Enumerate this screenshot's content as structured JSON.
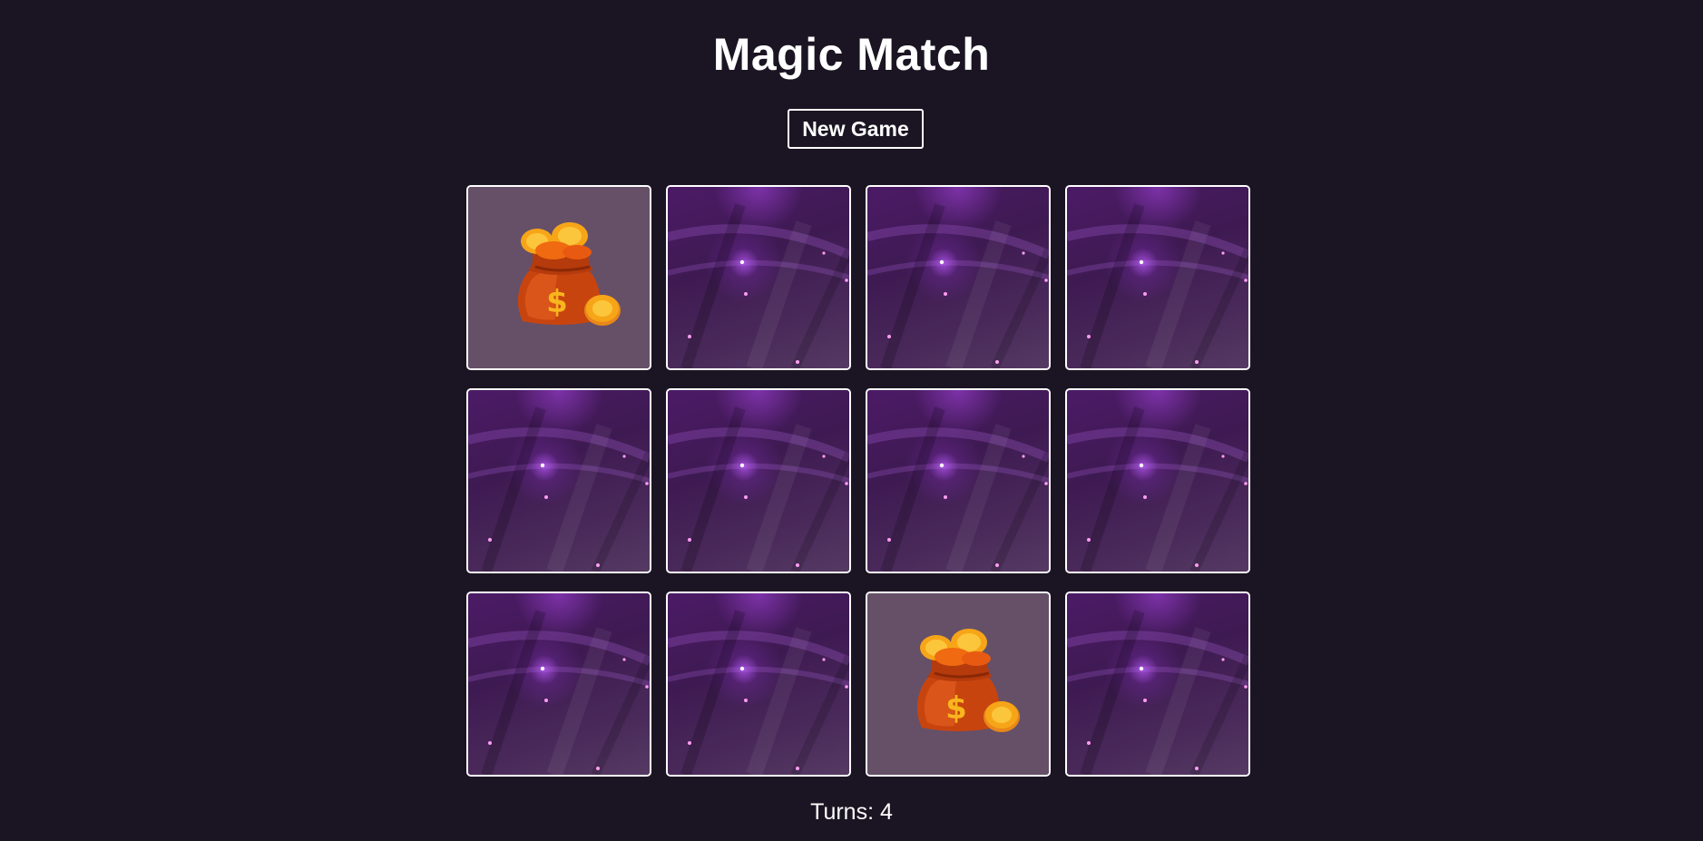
{
  "game": {
    "title": "Magic Match",
    "new_game_label": "New Game",
    "turns_label": "Turns:",
    "turns_value": "4",
    "turns_text": "Turns: 4"
  },
  "cards": [
    {
      "state": "face-up",
      "icon": "money-bag-icon"
    },
    {
      "state": "face-down",
      "icon": "card-back-icon"
    },
    {
      "state": "face-down",
      "icon": "card-back-icon"
    },
    {
      "state": "face-down",
      "icon": "card-back-icon"
    },
    {
      "state": "face-down",
      "icon": "card-back-icon"
    },
    {
      "state": "face-down",
      "icon": "card-back-icon"
    },
    {
      "state": "face-down",
      "icon": "card-back-icon"
    },
    {
      "state": "face-down",
      "icon": "card-back-icon"
    },
    {
      "state": "face-down",
      "icon": "card-back-icon"
    },
    {
      "state": "face-down",
      "icon": "card-back-icon"
    },
    {
      "state": "face-up",
      "icon": "money-bag-icon"
    },
    {
      "state": "face-down",
      "icon": "card-back-icon"
    }
  ],
  "colors": {
    "background": "#1b1523",
    "card_border": "#ffffff",
    "face_up_background": "#655068",
    "card_back_primary": "#4c1a66",
    "coin_gold": "#f7a518",
    "bag_orange": "#c8440f"
  }
}
